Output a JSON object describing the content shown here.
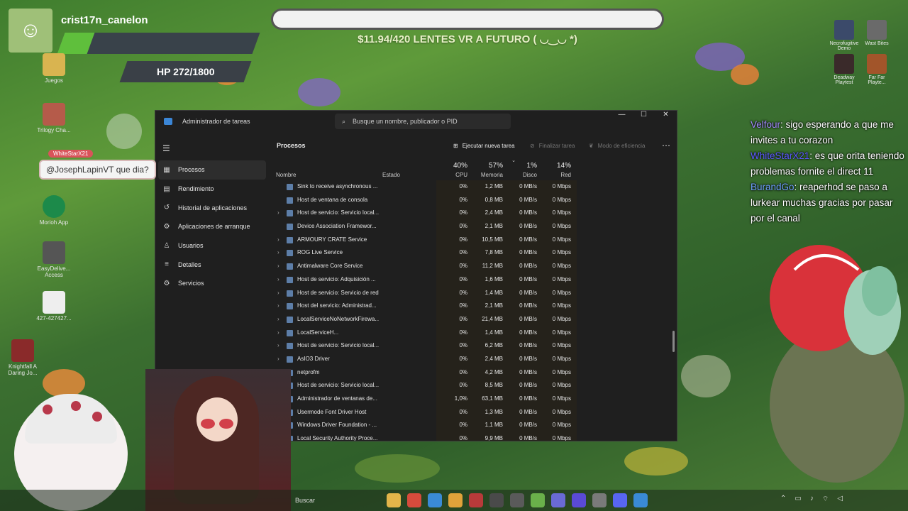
{
  "stream": {
    "username": "crist17n_canelon",
    "hp_text": "HP 272/1800",
    "hp_fraction": 0.151,
    "goal_text": "$11.94/420 LENTES VR A FUTURO ( ◡‿◡ *)",
    "mention_user": "WhiteStarX21",
    "mention_text": "@JosephLapinVT que dia?"
  },
  "chat": [
    {
      "user": "Velfour",
      "text": ": sigo esperando a que me invites a tu corazon"
    },
    {
      "user": "WhiteStarX21",
      "text": ": es que orita teniendo problemas fornite el direct 11"
    },
    {
      "user": "BurandGo",
      "text": ": reaperhod se paso a lurkear muchas gracias por pasar por el canal"
    }
  ],
  "desktop_left": [
    {
      "label": "Juegos",
      "icon": "folder-icon"
    },
    {
      "label": "Trilogy Cha...",
      "icon": "game-icon"
    },
    {
      "label": "Morioh App",
      "icon": "app-icon"
    },
    {
      "label": "EasyDelive... Access",
      "icon": "app-icon"
    },
    {
      "label": "427-427427...",
      "icon": "image-icon"
    },
    {
      "label": "Knightfall A Daring Jo...",
      "icon": "game-icon"
    }
  ],
  "desktop_right": [
    {
      "label": "Necrofugitive Demo"
    },
    {
      "label": "Wast Bites"
    },
    {
      "label": "Deadway Playtest"
    },
    {
      "label": "Far Far Playte..."
    }
  ],
  "taskmanager": {
    "title": "Administrador de tareas",
    "search_placeholder": "Busque un nombre, publicador o PID",
    "nav": [
      {
        "label": "Procesos",
        "icon": "processes-icon",
        "active": true
      },
      {
        "label": "Rendimiento",
        "icon": "performance-icon"
      },
      {
        "label": "Historial de aplicaciones",
        "icon": "history-icon"
      },
      {
        "label": "Aplicaciones de arranque",
        "icon": "startup-icon"
      },
      {
        "label": "Usuarios",
        "icon": "users-icon"
      },
      {
        "label": "Detalles",
        "icon": "details-icon"
      },
      {
        "label": "Servicios",
        "icon": "services-icon"
      }
    ],
    "page_title": "Procesos",
    "toolbar": {
      "run_task": "Ejecutar nueva tarea",
      "end_task": "Finalizar tarea",
      "efficiency": "Modo de eficiencia"
    },
    "columns": {
      "name": "Nombre",
      "status": "Estado",
      "cpu_pct": "40%",
      "cpu": "CPU",
      "mem_pct": "57%",
      "mem": "Memoria",
      "disk_pct": "1%",
      "disk": "Disco",
      "net_pct": "14%",
      "net": "Red"
    },
    "rows": [
      {
        "expand": false,
        "name": "Sink to receive asynchronous ...",
        "cpu": "0%",
        "mem": "1,2 MB",
        "disk": "0 MB/s",
        "net": "0 Mbps"
      },
      {
        "expand": false,
        "name": "Host de ventana de consola",
        "cpu": "0%",
        "mem": "0,8 MB",
        "disk": "0 MB/s",
        "net": "0 Mbps"
      },
      {
        "expand": true,
        "name": "Host de servicio: Servicio local...",
        "cpu": "0%",
        "mem": "2,4 MB",
        "disk": "0 MB/s",
        "net": "0 Mbps"
      },
      {
        "expand": false,
        "name": "Device Association Framewor...",
        "cpu": "0%",
        "mem": "2,1 MB",
        "disk": "0 MB/s",
        "net": "0 Mbps"
      },
      {
        "expand": true,
        "name": "ARMOURY CRATE Service",
        "cpu": "0%",
        "mem": "10,5 MB",
        "disk": "0 MB/s",
        "net": "0 Mbps"
      },
      {
        "expand": true,
        "name": "ROG Live Service",
        "cpu": "0%",
        "mem": "7,8 MB",
        "disk": "0 MB/s",
        "net": "0 Mbps"
      },
      {
        "expand": true,
        "name": "Antimalware Core Service",
        "cpu": "0%",
        "mem": "11,2 MB",
        "disk": "0 MB/s",
        "net": "0 Mbps"
      },
      {
        "expand": true,
        "name": "Host de servicio: Adquisición ...",
        "cpu": "0%",
        "mem": "1,6 MB",
        "disk": "0 MB/s",
        "net": "0 Mbps"
      },
      {
        "expand": true,
        "name": "Host de servicio: Servicio de red",
        "cpu": "0%",
        "mem": "1,4 MB",
        "disk": "0 MB/s",
        "net": "0 Mbps"
      },
      {
        "expand": true,
        "name": "Host del servicio: Administrad...",
        "cpu": "0%",
        "mem": "2,1 MB",
        "disk": "0 MB/s",
        "net": "0 Mbps"
      },
      {
        "expand": true,
        "name": "LocalServiceNoNetworkFirewa...",
        "cpu": "0%",
        "mem": "21,4 MB",
        "disk": "0 MB/s",
        "net": "0 Mbps"
      },
      {
        "expand": true,
        "name": "LocalServiceH...",
        "cpu": "0%",
        "mem": "1,4 MB",
        "disk": "0 MB/s",
        "net": "0 Mbps"
      },
      {
        "expand": true,
        "name": "Host de servicio: Servicio local...",
        "cpu": "0%",
        "mem": "6,2 MB",
        "disk": "0 MB/s",
        "net": "0 Mbps"
      },
      {
        "expand": true,
        "name": "AsIO3 Driver",
        "cpu": "0%",
        "mem": "2,4 MB",
        "disk": "0 MB/s",
        "net": "0 Mbps"
      },
      {
        "expand": false,
        "name": "netprofm",
        "cpu": "0%",
        "mem": "4,2 MB",
        "disk": "0 MB/s",
        "net": "0 Mbps"
      },
      {
        "expand": false,
        "name": "Host de servicio: Servicio local...",
        "cpu": "0%",
        "mem": "8,5 MB",
        "disk": "0 MB/s",
        "net": "0 Mbps"
      },
      {
        "expand": false,
        "name": "Administrador de ventanas de...",
        "cpu": "1,0%",
        "mem": "63,1 MB",
        "disk": "0 MB/s",
        "net": "0 Mbps"
      },
      {
        "expand": false,
        "name": "Usermode Font Driver Host",
        "cpu": "0%",
        "mem": "1,3 MB",
        "disk": "0 MB/s",
        "net": "0 Mbps"
      },
      {
        "expand": false,
        "name": "Windows Driver Foundation - ...",
        "cpu": "0%",
        "mem": "1,1 MB",
        "disk": "0 MB/s",
        "net": "0 Mbps"
      },
      {
        "expand": false,
        "name": "Local Security Authority Proce...",
        "cpu": "0%",
        "mem": "9,9 MB",
        "disk": "0 MB/s",
        "net": "0 Mbps"
      }
    ]
  },
  "taskbar": {
    "search_label": "Buscar",
    "icons": [
      "file-explorer-icon",
      "chrome-icon",
      "browser-icon",
      "chrome-icon",
      "game-icon",
      "app-icon",
      "obs-icon",
      "app-icon",
      "app-icon",
      "vs-icon",
      "settings-icon",
      "discord-icon",
      "app-icon"
    ]
  },
  "colors": {
    "tm_bg": "#1f1f1f",
    "hp_green": "#5fbf3c",
    "chat_user1": "#a58bff",
    "chat_user2": "#5e5bff",
    "chat_user3": "#6fa0ff"
  }
}
